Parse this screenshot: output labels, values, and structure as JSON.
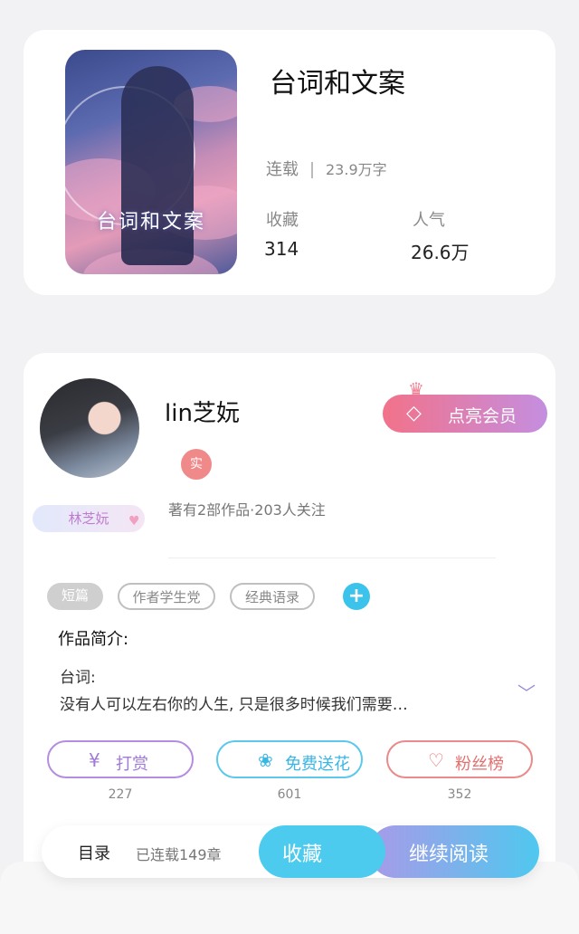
{
  "book": {
    "cover_title": "台词和文案",
    "title": "台词和文案",
    "status": "连载",
    "word_count": "23.9万字",
    "stats": [
      {
        "label": "收藏",
        "value": "314"
      },
      {
        "label": "人气",
        "value": "26.6万"
      }
    ]
  },
  "author": {
    "name": "lin芝妧",
    "badge": "实",
    "signature": "林芝妧",
    "meta": "著有2部作品·203人关注",
    "vip_button": "点亮会员"
  },
  "tags": [
    "短篇",
    "作者学生党",
    "经典语录"
  ],
  "intro": {
    "title": "作品简介:",
    "line1": "台词:",
    "line2": "没有人可以左右你的人生, 只是很多时候我们需要…"
  },
  "actions": [
    {
      "label": "打赏",
      "count": "227",
      "icon": "yen-coin-icon",
      "color": "#a07ad8"
    },
    {
      "label": "免费送花",
      "count": "601",
      "icon": "flower-icon",
      "color": "#39b6e4"
    },
    {
      "label": "粉丝榜",
      "count": "352",
      "icon": "fan-user-icon",
      "color": "#e27070"
    }
  ],
  "bottom_bar": {
    "toc": "目录",
    "progress": "已连载149章",
    "collect": "收藏",
    "continue_reading": "继续阅读"
  }
}
